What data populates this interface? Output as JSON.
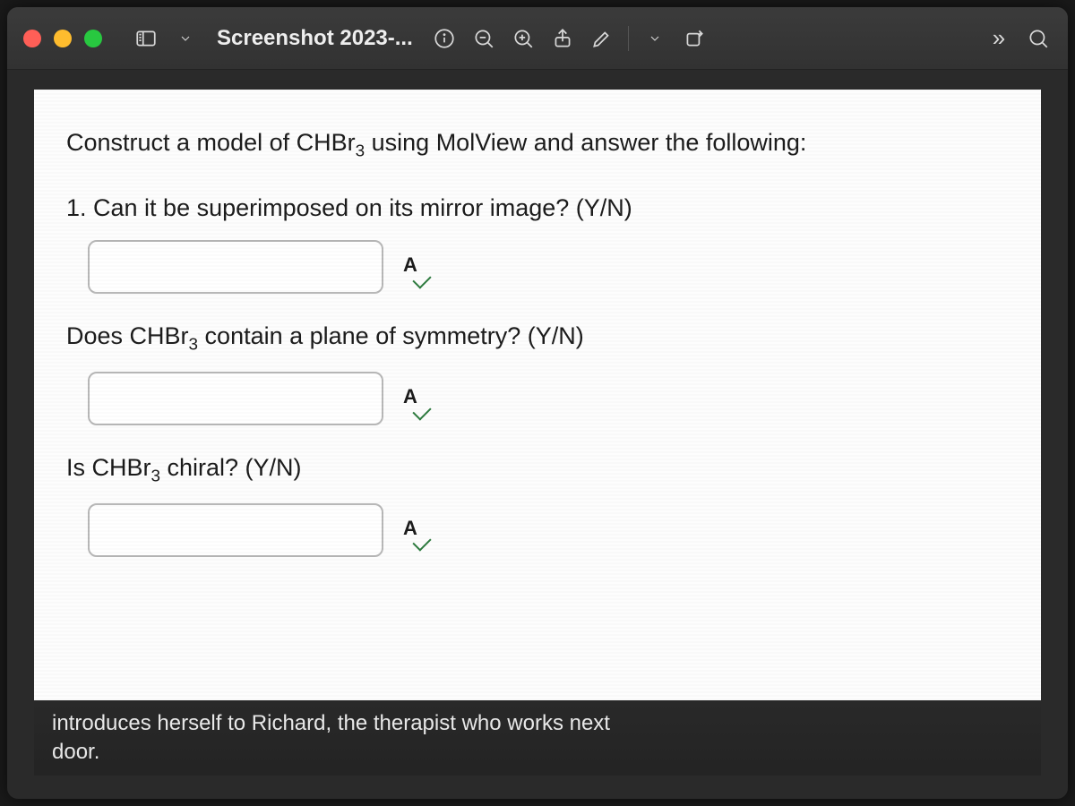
{
  "toolbar": {
    "title": "Screenshot 2023-..."
  },
  "content": {
    "intro_pre": "Construct a model of CHBr",
    "intro_sub": "3",
    "intro_post": " using MolView and answer the following:",
    "q1": "1. Can it be superimposed on its mirror image? (Y/N)",
    "q2_pre": "Does CHBr",
    "q2_sub": "3",
    "q2_post": " contain a plane of symmetry? (Y/N)",
    "q3_pre": "Is CHBr",
    "q3_sub": "3",
    "q3_post": " chiral? (Y/N)",
    "spell_label": "A"
  },
  "caption": "introduces herself to Richard, the therapist who works next door."
}
